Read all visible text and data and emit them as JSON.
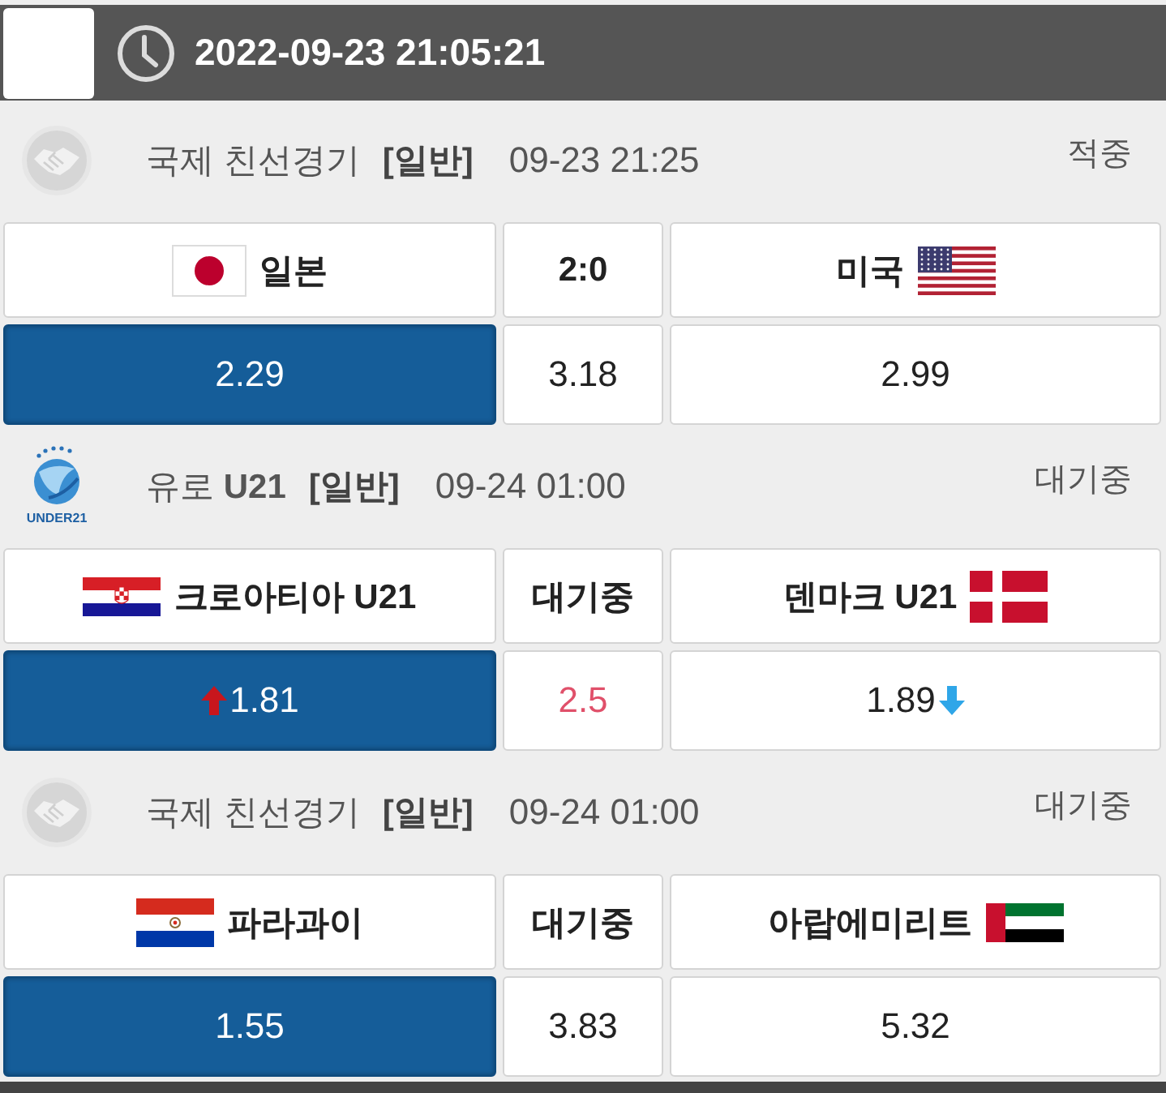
{
  "top_bar": {
    "time": "2022-09-23 21:05:21"
  },
  "matches": [
    {
      "league_logo": {
        "kind": "handshake"
      },
      "league": "국제 친선경기",
      "category": "[일반]",
      "start_time": "09-23 21:25",
      "status": "적중",
      "home": {
        "name": "일본",
        "kind": "japan"
      },
      "center": "2:0",
      "away": {
        "name": "미국",
        "kind": "usa"
      },
      "odds": [
        {
          "value": "2.29",
          "selected": true,
          "highlighted": false,
          "kind": "plain"
        },
        {
          "value": "3.18",
          "selected": false,
          "highlighted": false,
          "kind": "plain"
        },
        {
          "value": "2.99",
          "selected": false,
          "highlighted": false,
          "kind": "plain"
        }
      ]
    },
    {
      "league_logo": {
        "kind": "u21",
        "caption": "UNDER21"
      },
      "league": "유로 **U21**",
      "category": "[일반]",
      "start_time": "09-24 01:00",
      "status": "대기중",
      "home": {
        "name": "크로아티아 U21",
        "kind": "croatia"
      },
      "center": "대기중",
      "away": {
        "name": "덴마크 U21",
        "kind": "denmark"
      },
      "odds": [
        {
          "value": "1.81",
          "selected": true,
          "highlighted": false,
          "kind": "up"
        },
        {
          "value": "2.5",
          "selected": false,
          "highlighted": true,
          "kind": "plain"
        },
        {
          "value": "1.89",
          "selected": false,
          "highlighted": false,
          "kind": "down"
        }
      ]
    },
    {
      "league_logo": {
        "kind": "handshake"
      },
      "league": "국제 친선경기",
      "category": "[일반]",
      "start_time": "09-24 01:00",
      "status": "대기중",
      "home": {
        "name": "파라과이",
        "kind": "paraguay"
      },
      "center": "대기중",
      "away": {
        "name": "아랍에미리트",
        "kind": "uae"
      },
      "odds": [
        {
          "value": "1.55",
          "selected": true,
          "highlighted": false,
          "kind": "plain"
        },
        {
          "value": "3.83",
          "selected": false,
          "highlighted": false,
          "kind": "plain"
        },
        {
          "value": "5.32",
          "selected": false,
          "highlighted": false,
          "kind": "plain"
        }
      ]
    }
  ]
}
